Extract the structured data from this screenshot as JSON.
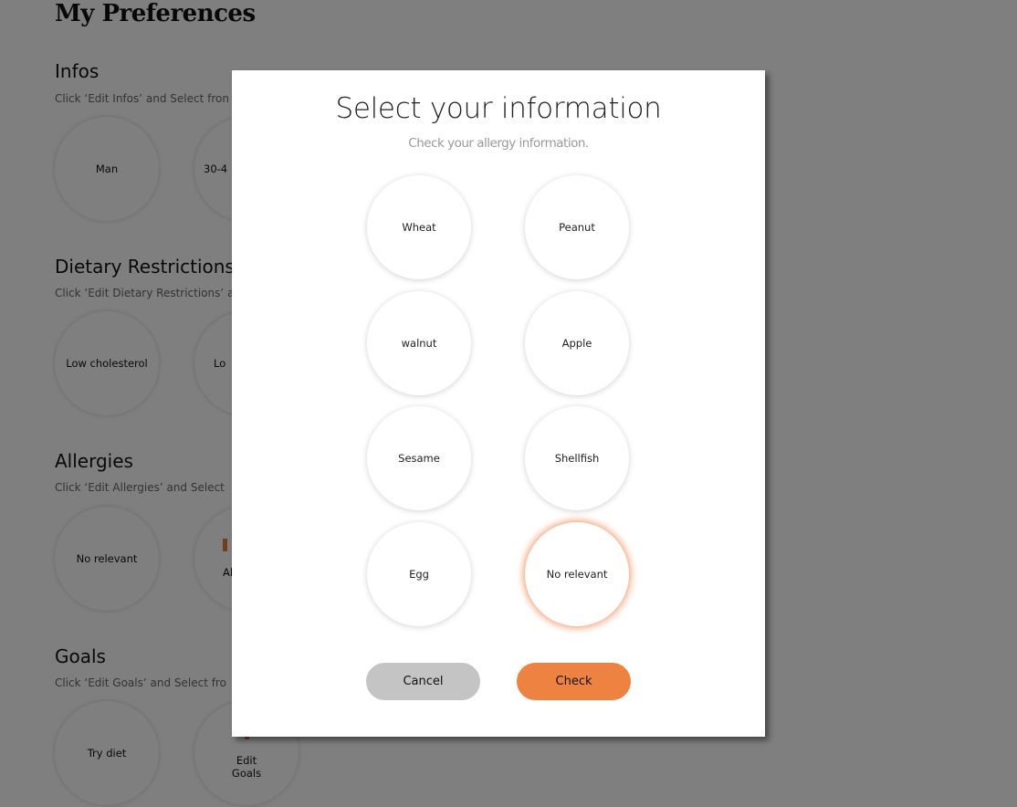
{
  "page": {
    "title": "My Preferences",
    "sections": [
      {
        "heading": "Infos",
        "desc": "Click ‘Edit Infos’ and Select fron",
        "items": [
          "Man",
          "30-4"
        ]
      },
      {
        "heading": "Dietary Restrictions",
        "desc": "Click ‘Edit Dietary Restrictions’ a",
        "items": [
          "Low cholesterol",
          "Lo"
        ]
      },
      {
        "heading": "Allergies",
        "desc": "Click ‘Edit Allergies’ and Select",
        "items": [
          "No relevant",
          "Al"
        ]
      },
      {
        "heading": "Goals",
        "desc": "Click ‘Edit Goals’ and Select fro",
        "items": [
          "Try diet"
        ],
        "edit_label": "Edit Goals"
      }
    ]
  },
  "modal": {
    "title": "Select your information",
    "subtitle": "Check your allergy information.",
    "options": [
      {
        "label": "Wheat",
        "selected": false
      },
      {
        "label": "Peanut",
        "selected": false
      },
      {
        "label": "walnut",
        "selected": false
      },
      {
        "label": "Apple",
        "selected": false
      },
      {
        "label": "Sesame",
        "selected": false
      },
      {
        "label": "Shellfish",
        "selected": false
      },
      {
        "label": "Egg",
        "selected": false
      },
      {
        "label": "No relevant",
        "selected": true
      }
    ],
    "cancel_label": "Cancel",
    "check_label": "Check"
  },
  "colors": {
    "accent": "#ee8240",
    "cancel": "#c4c4c4",
    "selected_glow": "#f08246"
  }
}
